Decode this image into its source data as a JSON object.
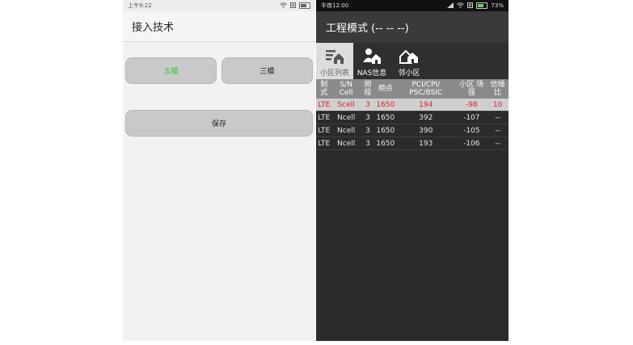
{
  "left_phone": {
    "status_bar": {
      "time": "上午9:22"
    },
    "title": "接入技术",
    "buttons": {
      "five_mode": "五模",
      "three_mode": "三模",
      "save": "保存"
    },
    "colors": {
      "five_mode_text": "#33cc33"
    }
  },
  "right_phone": {
    "status_bar": {
      "time": "半夜12:00",
      "battery": "73%"
    },
    "title": "工程模式 (-- -- --)",
    "tabs": [
      {
        "label": "小区列表",
        "icon": "cell-list-icon",
        "active": true
      },
      {
        "label": "NAS信息",
        "icon": "nas-user-icon",
        "active": false
      },
      {
        "label": "邻小区",
        "icon": "neighbor-cell-icon",
        "active": false
      }
    ],
    "table": {
      "headers": [
        "制式",
        "S/N Cell",
        "频段",
        "频点",
        "PCI/CPI/ PSC/BSIC",
        "小区 场强",
        "信噪比"
      ],
      "rows": [
        [
          "LTE",
          "Scell",
          "3",
          "1650",
          "194",
          "-98",
          "10"
        ],
        [
          "LTE",
          "Ncell",
          "3",
          "1650",
          "392",
          "-107",
          "--"
        ],
        [
          "LTE",
          "Ncell",
          "3",
          "1650",
          "390",
          "-105",
          "--"
        ],
        [
          "LTE",
          "Ncell",
          "3",
          "1650",
          "193",
          "-106",
          "--"
        ]
      ]
    },
    "colors": {
      "serving_row_text": "#e02020"
    }
  }
}
